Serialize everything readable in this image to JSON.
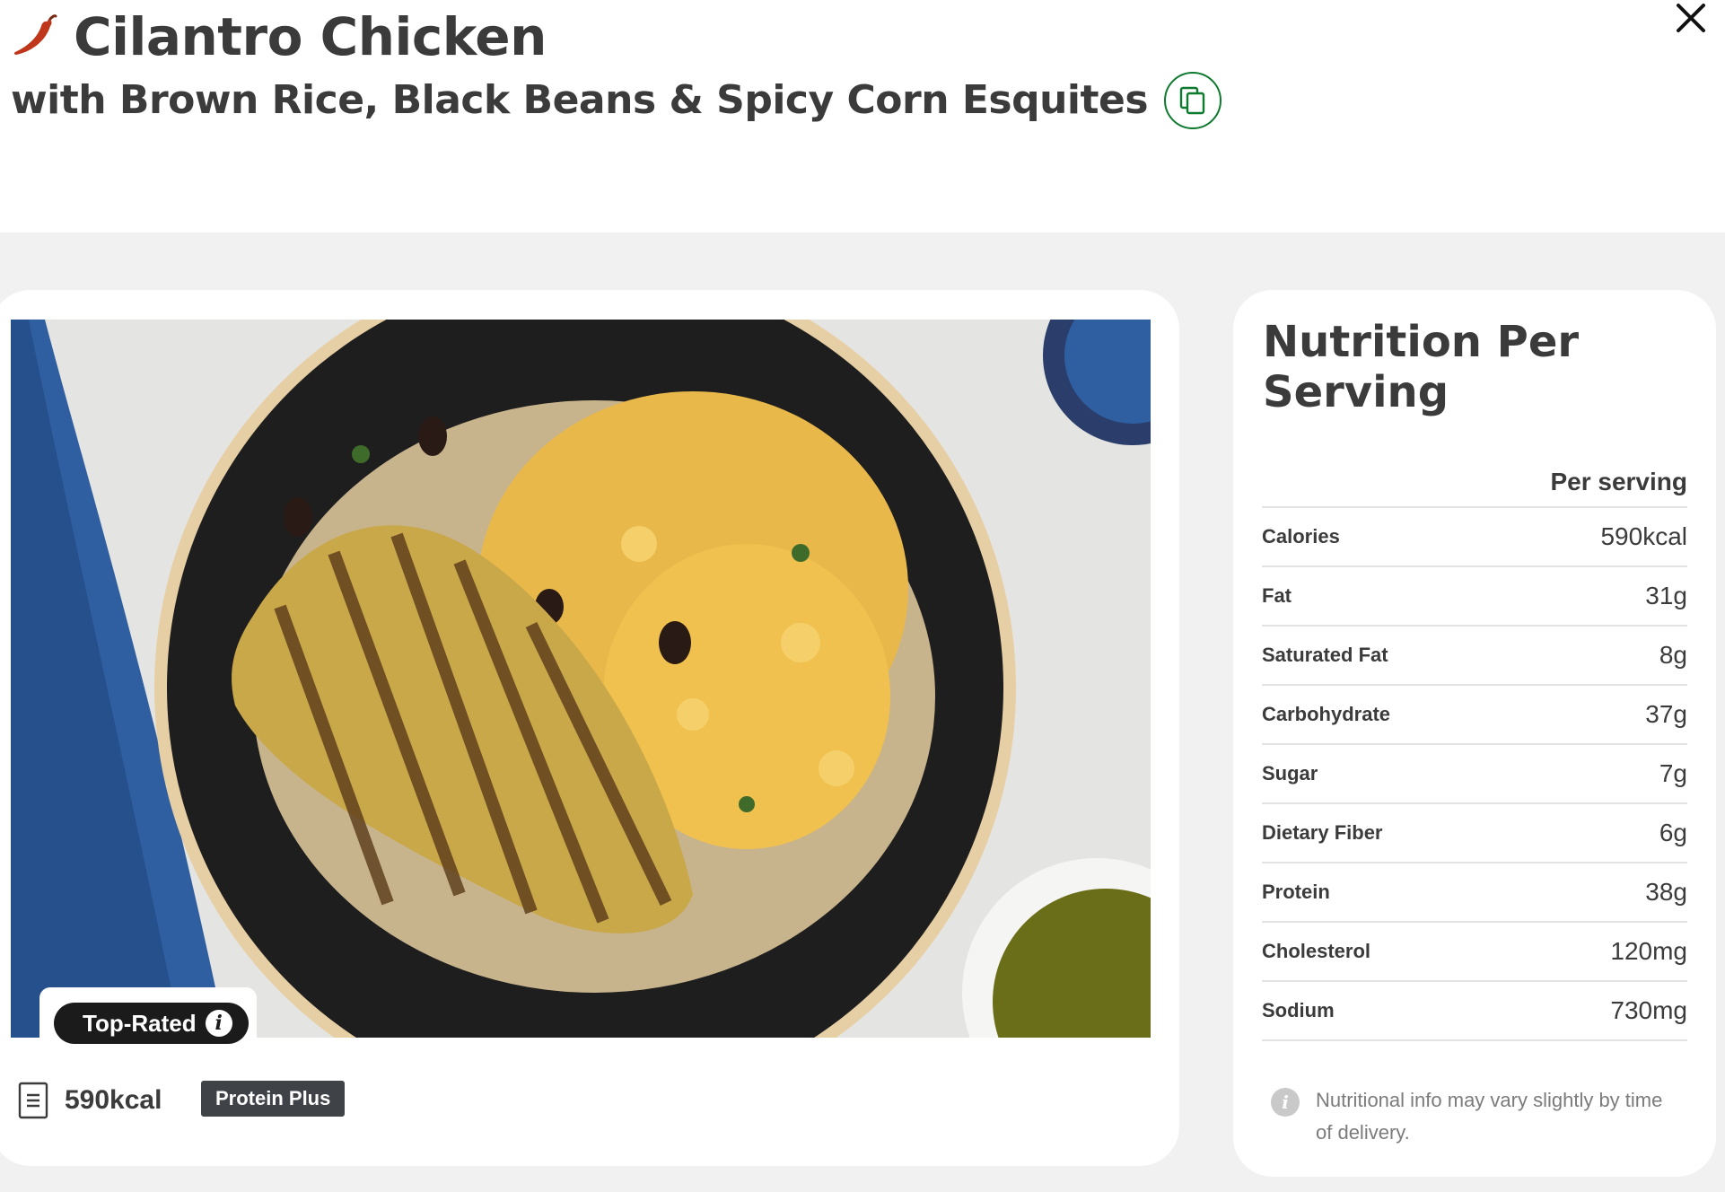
{
  "header": {
    "title": "Cilantro Chicken",
    "subtitle": "with Brown Rice, Black Beans & Spicy Corn Esquites",
    "spicy_icon": "chili-pepper-icon",
    "copy_icon": "copy-icon",
    "close_icon": "close-icon"
  },
  "recipe": {
    "photo_alt": "Cilantro Chicken with Brown Rice, Black Beans & Spicy Corn Esquites",
    "badge": "Top-Rated",
    "calories": "590kcal",
    "tag": "Protein Plus"
  },
  "nutrition": {
    "title": "Nutrition Per Serving",
    "column_header": "Per serving",
    "rows": [
      {
        "label": "Calories",
        "value": "590kcal"
      },
      {
        "label": "Fat",
        "value": "31g"
      },
      {
        "label": "Saturated Fat",
        "value": "8g"
      },
      {
        "label": "Carbohydrate",
        "value": "37g"
      },
      {
        "label": "Sugar",
        "value": "7g"
      },
      {
        "label": "Dietary Fiber",
        "value": "6g"
      },
      {
        "label": "Protein",
        "value": "38g"
      },
      {
        "label": "Cholesterol",
        "value": "120mg"
      },
      {
        "label": "Sodium",
        "value": "730mg"
      }
    ],
    "note": "Nutritional info may vary slightly by time of delivery."
  },
  "colors": {
    "accent_green": "#0e7a2f",
    "chili_red": "#c0361b",
    "badge_dark": "#1b1b1b",
    "tag_dark": "#3f4247"
  }
}
